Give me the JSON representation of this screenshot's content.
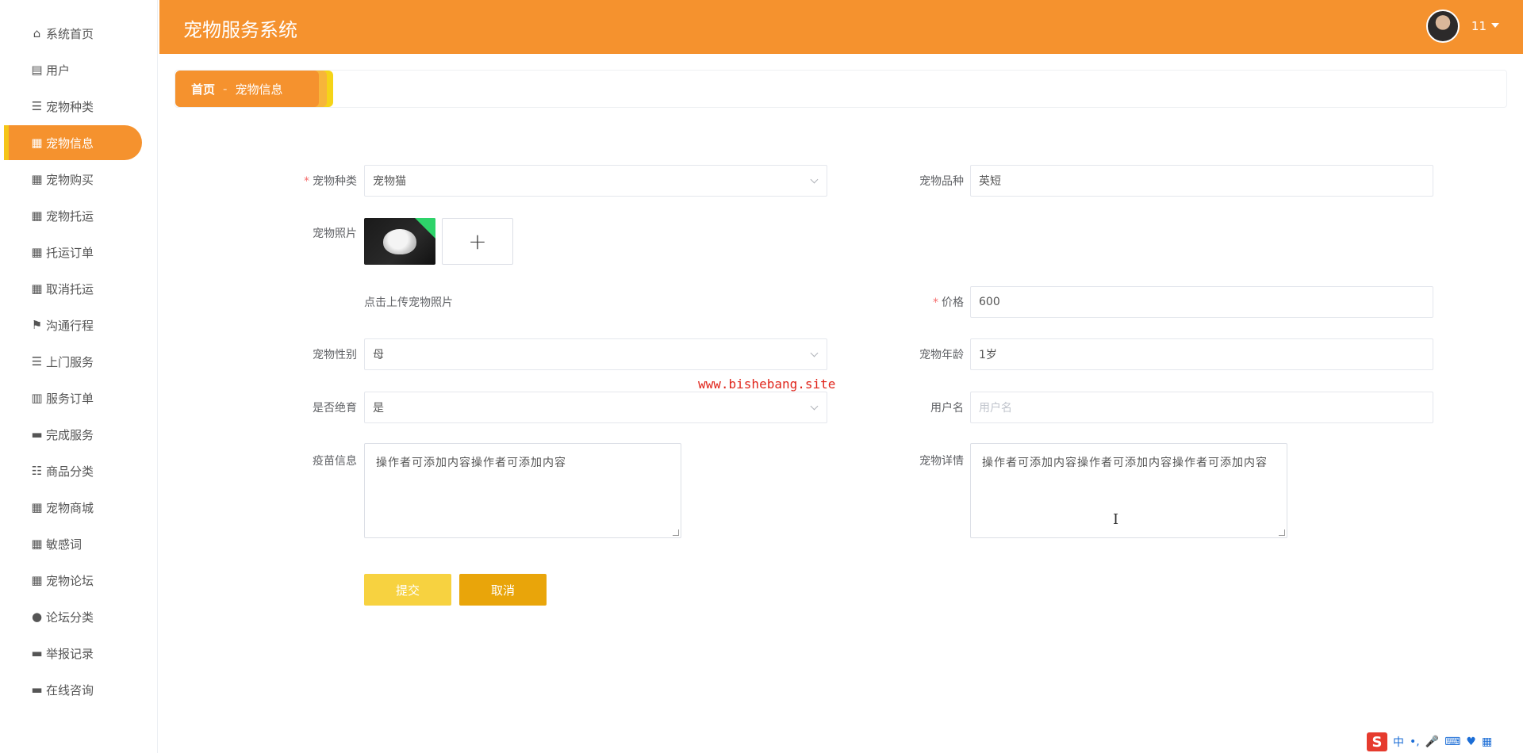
{
  "app": {
    "title": "宠物服务系统",
    "user": "11"
  },
  "sidebar": {
    "items": [
      {
        "label": "系统首页",
        "icon": "⌂"
      },
      {
        "label": "用户",
        "icon": "▤"
      },
      {
        "label": "宠物种类",
        "icon": "☰"
      },
      {
        "label": "宠物信息",
        "icon": "▦",
        "active": true
      },
      {
        "label": "宠物购买",
        "icon": "▦"
      },
      {
        "label": "宠物托运",
        "icon": "▦"
      },
      {
        "label": "托运订单",
        "icon": "▦"
      },
      {
        "label": "取消托运",
        "icon": "▦"
      },
      {
        "label": "沟通行程",
        "icon": "⚑"
      },
      {
        "label": "上门服务",
        "icon": "☰"
      },
      {
        "label": "服务订单",
        "icon": "▥"
      },
      {
        "label": "完成服务",
        "icon": "▬"
      },
      {
        "label": "商品分类",
        "icon": "☷"
      },
      {
        "label": "宠物商城",
        "icon": "▦"
      },
      {
        "label": "敏感词",
        "icon": "▦"
      },
      {
        "label": "宠物论坛",
        "icon": "▦"
      },
      {
        "label": "论坛分类",
        "icon": "●"
      },
      {
        "label": "举报记录",
        "icon": "▬"
      },
      {
        "label": "在线咨询",
        "icon": "▬"
      }
    ]
  },
  "breadcrumb": {
    "home": "首页",
    "sep": "-",
    "current": "宠物信息"
  },
  "form": {
    "pet_type": {
      "label": "宠物种类",
      "value": "宠物猫"
    },
    "pet_breed": {
      "label": "宠物品种",
      "value": "英短"
    },
    "pet_photo": {
      "label": "宠物照片",
      "plus": "+",
      "hint": "点击上传宠物照片"
    },
    "price": {
      "label": "价格",
      "value": "600"
    },
    "pet_gender": {
      "label": "宠物性别",
      "value": "母"
    },
    "pet_age": {
      "label": "宠物年龄",
      "value": "1岁"
    },
    "sterilized": {
      "label": "是否绝育",
      "value": "是"
    },
    "username": {
      "label": "用户名",
      "placeholder": "用户名"
    },
    "vaccine": {
      "label": "疫苗信息",
      "value": "操作者可添加内容操作者可添加内容"
    },
    "details": {
      "label": "宠物详情",
      "value": "操作者可添加内容操作者可添加内容操作者可添加内容"
    },
    "submit_label": "提交",
    "cancel_label": "取消"
  },
  "watermark": "www.bishebang.site",
  "tray": {
    "logo": "S",
    "lang": "中"
  }
}
